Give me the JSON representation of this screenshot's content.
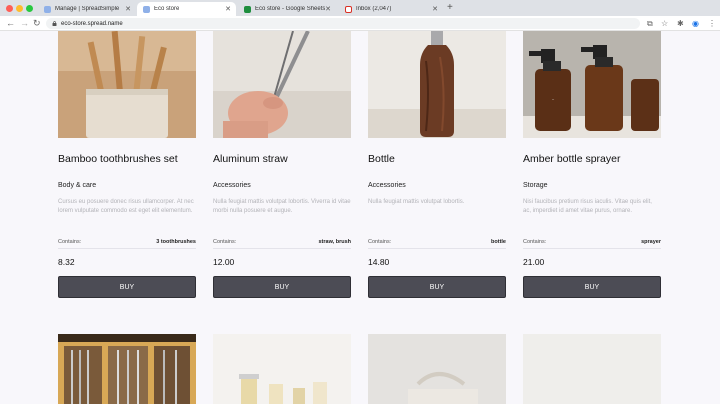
{
  "browser": {
    "tabs": [
      {
        "label": "Manage | SpreadSimple",
        "active": false,
        "favicon_color": "#8fb0e8"
      },
      {
        "label": "Eco store",
        "active": true,
        "favicon_color": "#8fb0e8"
      },
      {
        "label": "Eco store - Google Sheets",
        "active": false,
        "favicon_color": "#1e8e3e"
      },
      {
        "label": "Inbox (2,047)",
        "active": false,
        "favicon_color": "#d93025"
      }
    ],
    "url": "eco-store.spread.name"
  },
  "products": [
    {
      "title": "Bamboo toothbrushes set",
      "category": "Body & care",
      "description": "Cursus eu posuere donec risus ullamcorper. At nec lorem vulputate commodo est eget elit elementum.",
      "contains_label": "Contains:",
      "contains_value": "3 toothbrushes",
      "price": "8.32",
      "button": "BUY"
    },
    {
      "title": "Aluminum straw",
      "category": "Accessories",
      "description": "Nulla feugiat mattis volutpat lobortis. Viverra id vitae morbi nulla posuere et augue.",
      "contains_label": "Contains:",
      "contains_value": "straw, brush",
      "price": "12.00",
      "button": "BUY"
    },
    {
      "title": "Bottle",
      "category": "Accessories",
      "description": "Nulla feugiat mattis volutpat lobortis.",
      "contains_label": "Contains:",
      "contains_value": "bottle",
      "price": "14.80",
      "button": "BUY"
    },
    {
      "title": "Amber bottle sprayer",
      "category": "Storage",
      "description": "Nisi faucibus pretium risus iaculis. Vitae quis elit, ac, imperdiet id amet vitae purus, ornare.",
      "contains_label": "Contains:",
      "contains_value": "sprayer",
      "price": "21.00",
      "button": "BUY"
    }
  ],
  "colors": {
    "button_bg": "#4c4c55",
    "page_bg": "#f8f7fb"
  }
}
